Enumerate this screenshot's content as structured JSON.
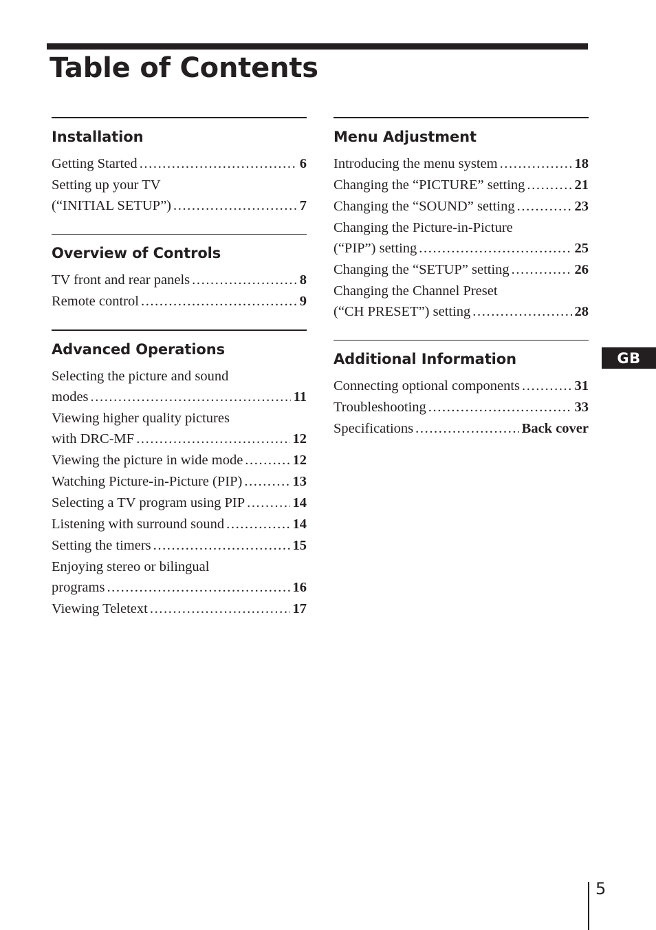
{
  "document": {
    "title": "Table of Contents",
    "page_number": "5",
    "region_badge": "GB",
    "accent_color": "#231f20",
    "background_color": "#ffffff"
  },
  "columns": {
    "left": [
      {
        "heading": "Installation",
        "entries": [
          {
            "line1": "",
            "label": "Getting Started",
            "page": "6"
          },
          {
            "line1": "Setting up your TV",
            "label": "(“INITIAL SETUP”)",
            "page": "7"
          }
        ]
      },
      {
        "heading": "Overview of Controls",
        "entries": [
          {
            "line1": "",
            "label": "TV front and rear panels",
            "page": "8"
          },
          {
            "line1": "",
            "label": "Remote control",
            "page": "9"
          }
        ]
      },
      {
        "heading": "Advanced Operations",
        "entries": [
          {
            "line1": "Selecting the picture and sound",
            "label": "modes",
            "page": "11"
          },
          {
            "line1": "Viewing higher quality pictures",
            "label": "with DRC-MF",
            "page": "12"
          },
          {
            "line1": "",
            "label": "Viewing the picture in wide mode",
            "page": "12"
          },
          {
            "line1": "",
            "label": "Watching Picture-in-Picture (PIP)",
            "page": "13"
          },
          {
            "line1": "",
            "label": "Selecting a TV program using PIP",
            "page": "14"
          },
          {
            "line1": "",
            "label": "Listening with surround sound",
            "page": "14"
          },
          {
            "line1": "",
            "label": "Setting the timers",
            "page": "15"
          },
          {
            "line1": "Enjoying stereo or bilingual",
            "label": "programs",
            "page": "16"
          },
          {
            "line1": "",
            "label": "Viewing Teletext",
            "page": "17"
          }
        ]
      }
    ],
    "right": [
      {
        "heading": "Menu Adjustment",
        "entries": [
          {
            "line1": "",
            "label": "Introducing the menu system",
            "page": "18"
          },
          {
            "line1": "",
            "label": "Changing the “PICTURE” setting",
            "page": "21"
          },
          {
            "line1": "",
            "label": "Changing the “SOUND” setting",
            "page": "23"
          },
          {
            "line1": "Changing the Picture-in-Picture",
            "label": "(“PIP”) setting",
            "page": "25"
          },
          {
            "line1": "",
            "label": "Changing the “SETUP” setting",
            "page": "26"
          },
          {
            "line1": "Changing the Channel Preset",
            "label": "(“CH PRESET”) setting",
            "page": "28"
          }
        ]
      },
      {
        "heading": "Additional Information",
        "entries": [
          {
            "line1": "",
            "label": "Connecting optional components",
            "page": "31"
          },
          {
            "line1": "",
            "label": "Troubleshooting",
            "page": "33"
          },
          {
            "line1": "",
            "label": "Specifications",
            "page": "Back cover"
          }
        ]
      }
    ]
  }
}
